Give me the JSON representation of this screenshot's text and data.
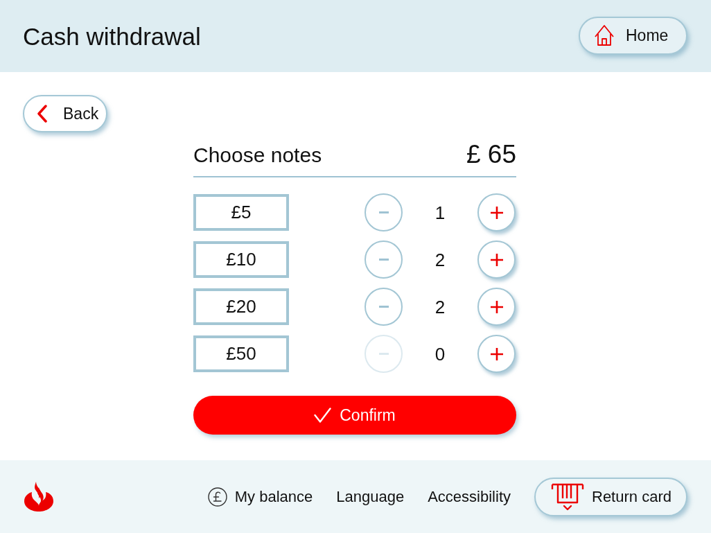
{
  "header": {
    "title": "Cash withdrawal",
    "home_button": "Home"
  },
  "back_button": "Back",
  "notes_panel": {
    "title": "Choose notes",
    "total": "£ 65",
    "rows": [
      {
        "note": "£5",
        "count": "1",
        "decrease_disabled": false
      },
      {
        "note": "£10",
        "count": "2",
        "decrease_disabled": false
      },
      {
        "note": "£20",
        "count": "2",
        "decrease_disabled": false
      },
      {
        "note": "£50",
        "count": "0",
        "decrease_disabled": true
      }
    ],
    "confirm_button": "Confirm"
  },
  "footer": {
    "links": [
      {
        "label": "My balance",
        "kind": "balance"
      },
      {
        "label": "Language",
        "kind": "plain"
      },
      {
        "label": "Accessibility",
        "kind": "plain"
      }
    ],
    "return_card_button": "Return card"
  }
}
